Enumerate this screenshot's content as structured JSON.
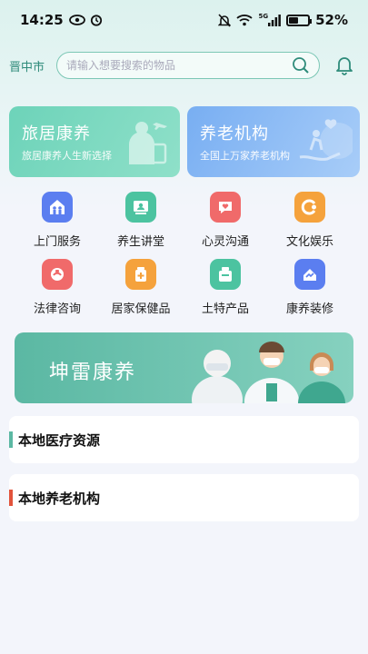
{
  "status_bar": {
    "time": "14:25",
    "signal_label": "5G",
    "battery": "52%",
    "battery_level": 0.52
  },
  "header": {
    "city": "晋中市",
    "search_placeholder": "请输入想要搜索的物品"
  },
  "promo_cards": [
    {
      "title": "旅居康养",
      "subtitle": "旅居康养人生新选择"
    },
    {
      "title": "养老机构",
      "subtitle": "全国上万家养老机构"
    }
  ],
  "services": [
    {
      "label": "上门服务",
      "color": "#5b7ef0",
      "icon": "home-people-icon"
    },
    {
      "label": "养生讲堂",
      "color": "#4cc3a0",
      "icon": "lecture-icon"
    },
    {
      "label": "心灵沟通",
      "color": "#f06a6a",
      "icon": "heart-chat-icon"
    },
    {
      "label": "文化娱乐",
      "color": "#f5a23c",
      "icon": "culture-icon"
    },
    {
      "label": "法律咨询",
      "color": "#f06a6a",
      "icon": "law-icon"
    },
    {
      "label": "居家保健品",
      "color": "#f5a23c",
      "icon": "health-product-icon"
    },
    {
      "label": "土特产品",
      "color": "#4cc3a0",
      "icon": "local-product-icon"
    },
    {
      "label": "康养装修",
      "color": "#5b7ef0",
      "icon": "renovation-icon"
    }
  ],
  "banner": {
    "title": "坤雷康养"
  },
  "sections": [
    {
      "title": "本地医疗资源",
      "accent": "#5bb8a3"
    },
    {
      "title": "本地养老机构",
      "accent": "#e2533b"
    }
  ]
}
